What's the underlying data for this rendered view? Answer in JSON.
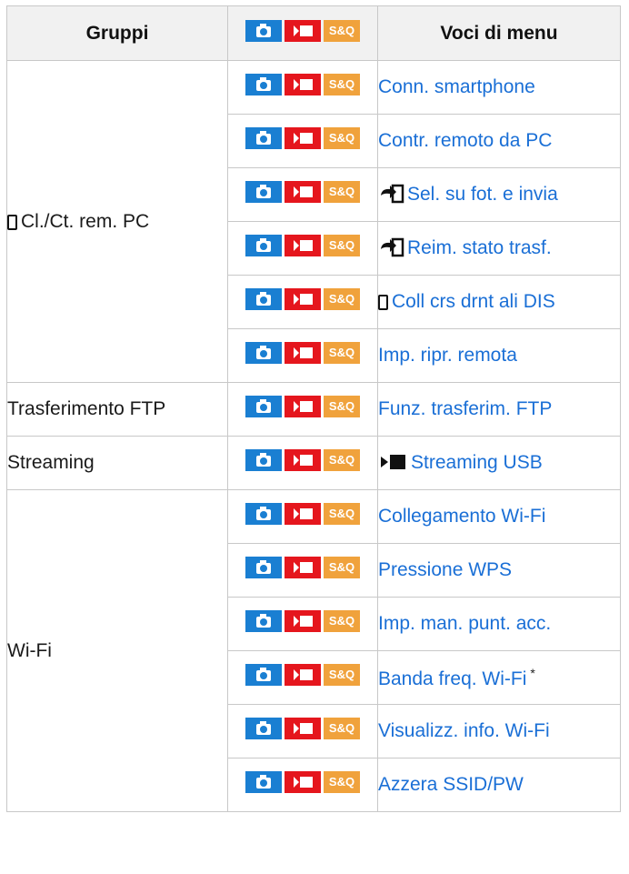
{
  "headers": {
    "groups": "Gruppi",
    "items": "Voci di menu"
  },
  "mode_icons": {
    "sq_label": "S&Q"
  },
  "rows": [
    {
      "item": "Conn. smartphone"
    },
    {
      "item": "Contr. remoto da PC"
    },
    {
      "item": "Sel. su fot. e invia",
      "icon": "send-icon"
    },
    {
      "item": "Reim. stato trasf.",
      "icon": "send-icon"
    },
    {
      "item": "Coll crs drnt ali DIS",
      "icon": "smartphone-icon"
    },
    {
      "item": "Imp. ripr. remota"
    },
    {
      "item": "Funz. trasferim. FTP"
    },
    {
      "item": "Streaming USB",
      "icon": "movie-stream-icon"
    },
    {
      "item": "Collegamento Wi-Fi"
    },
    {
      "item": "Pressione WPS"
    },
    {
      "item": "Imp. man. punt. acc."
    },
    {
      "item": "Banda freq. Wi-Fi",
      "note": "*"
    },
    {
      "item": "Visualizz. info. Wi-Fi"
    },
    {
      "item": "Azzera SSID/PW"
    }
  ],
  "groups": [
    {
      "label": "Cl./Ct. rem. PC",
      "icon": "smartphone-icon"
    },
    {
      "label": "Trasferimento FTP"
    },
    {
      "label": "Streaming"
    },
    {
      "label": "Wi-Fi"
    }
  ]
}
